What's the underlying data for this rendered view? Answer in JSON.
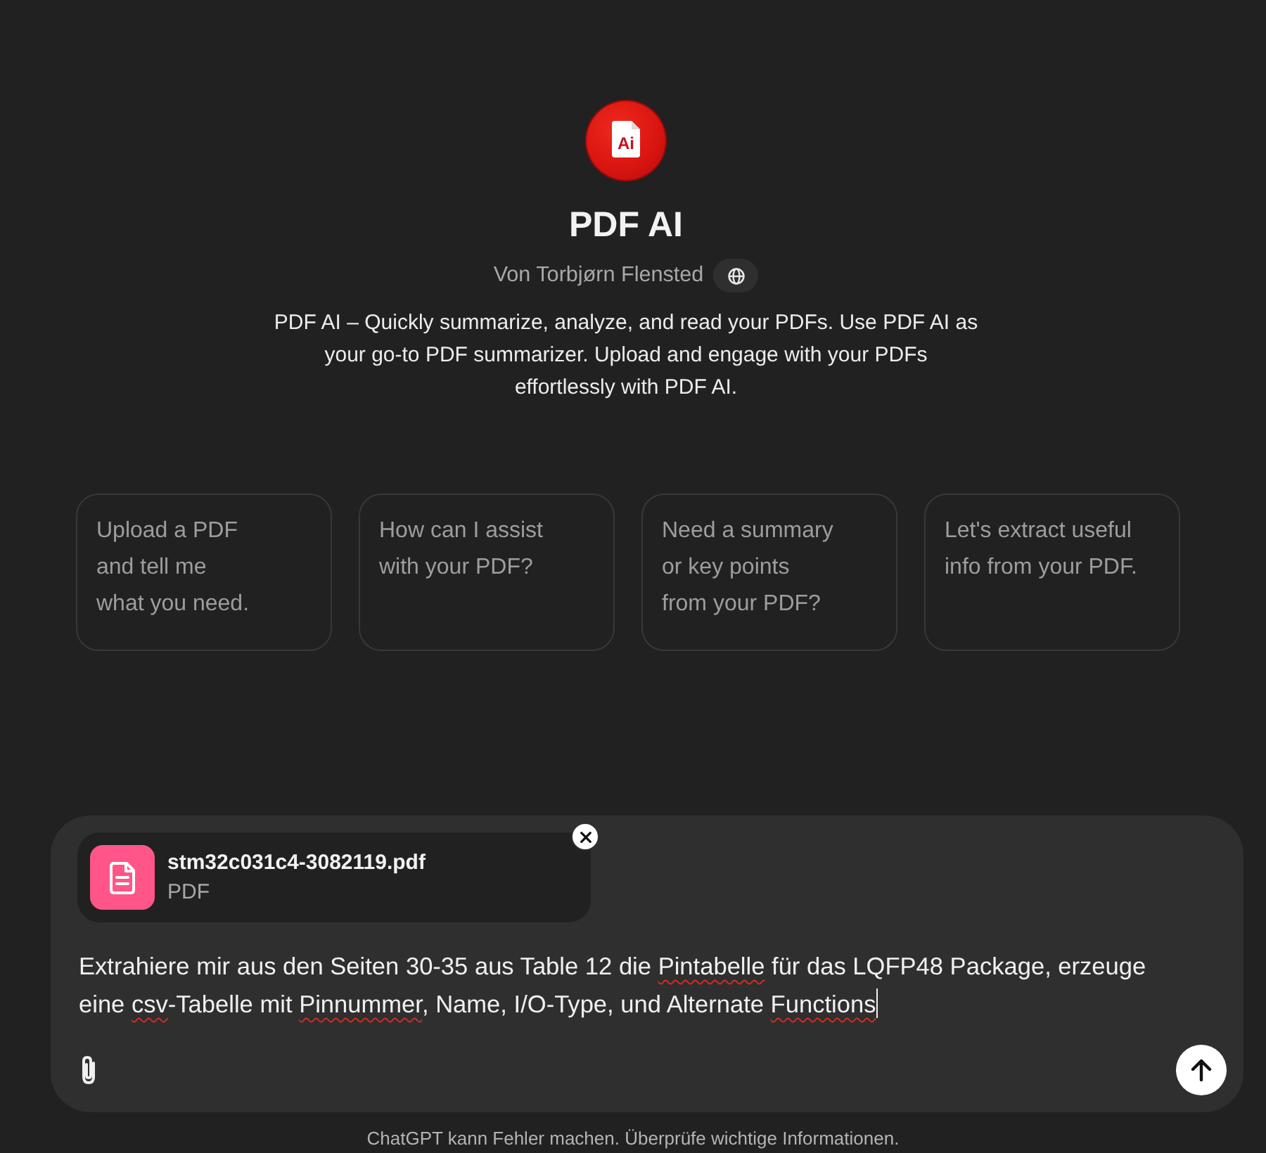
{
  "header": {
    "logo_text": "Ai",
    "title": "PDF AI",
    "author": "Von Torbjørn Flensted",
    "description": "PDF AI – Quickly summarize, analyze, and read your PDFs. Use PDF AI as your go-to PDF summarizer. Upload and engage with your PDFs effortlessly with PDF AI."
  },
  "suggestions": [
    {
      "text": "Upload a PDF\nand tell me\nwhat you need."
    },
    {
      "text": "How can I assist\nwith your PDF?"
    },
    {
      "text": "Need a summary\nor key points\nfrom your PDF?"
    },
    {
      "text": "Let's extract useful\ninfo from your PDF."
    }
  ],
  "composer": {
    "attachment": {
      "name": "stm32c031c4-3082119.pdf",
      "type": "PDF"
    },
    "message": {
      "focused": true,
      "segments": [
        {
          "text": "Extrahiere mir aus den Seiten 30-35 aus Table 12 die ",
          "spelling_error": false
        },
        {
          "text": "Pintabelle",
          "spelling_error": true
        },
        {
          "text": " für das LQFP48 Package, erzeuge eine ",
          "spelling_error": false
        },
        {
          "text": "csv",
          "spelling_error": true
        },
        {
          "text": "-Tabelle mit ",
          "spelling_error": false
        },
        {
          "text": "Pinnummer",
          "spelling_error": true
        },
        {
          "text": ", Name, I/O-Type, und Alternate ",
          "spelling_error": false
        },
        {
          "text": "Functions",
          "spelling_error": true
        }
      ]
    }
  },
  "footer": "ChatGPT kann Fehler machen. Überprüfe wichtige Informationen."
}
